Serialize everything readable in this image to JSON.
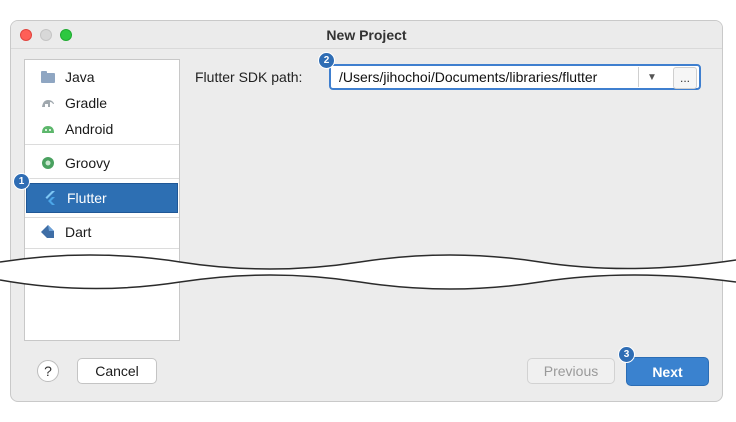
{
  "window": {
    "title": "New Project"
  },
  "sidebar": {
    "items": [
      {
        "label": "Java",
        "icon": "java-folder-icon"
      },
      {
        "label": "Gradle",
        "icon": "gradle-elephant-icon"
      },
      {
        "label": "Android",
        "icon": "android-icon"
      },
      {
        "label": "Groovy",
        "icon": "groovy-icon"
      },
      {
        "label": "Flutter",
        "icon": "flutter-icon",
        "selected": true
      },
      {
        "label": "Dart",
        "icon": "dart-icon"
      }
    ]
  },
  "sdk": {
    "label": "Flutter SDK path:",
    "value": "/Users/jihochoi/Documents/libraries/flutter",
    "dropdown_glyph": "▼",
    "browse_label": "..."
  },
  "footer": {
    "help_label": "?",
    "cancel_label": "Cancel",
    "previous_label": "Previous",
    "next_label": "Next"
  },
  "badges": [
    "1",
    "2",
    "3"
  ],
  "colors": {
    "accent": "#2d6fb3",
    "focus_border": "#3f7fcf",
    "badge": "#2f6db4",
    "close": "#ff5f57",
    "maximize": "#2dc840"
  }
}
